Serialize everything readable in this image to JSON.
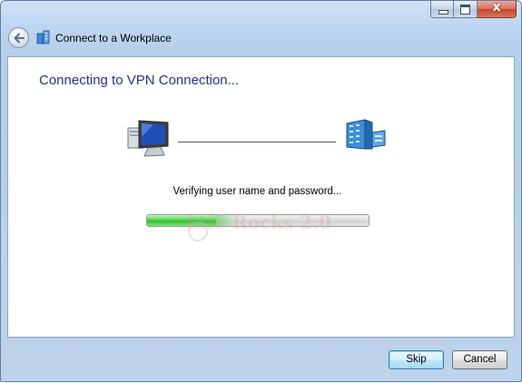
{
  "window": {
    "title": "Connect to a Workplace",
    "close_glyph": "x",
    "controls": [
      "minimize-icon",
      "maximize-icon",
      "close-icon"
    ]
  },
  "main": {
    "heading": "Connecting to VPN Connection...",
    "status": "Verifying user name and password...",
    "progress_fraction": 0.31,
    "watermark": "Life Rocks 2.0",
    "icons": [
      "computer-icon",
      "server-icon"
    ]
  },
  "footer": {
    "skip_label": "Skip",
    "cancel_label": "Cancel"
  },
  "colors": {
    "heading": "#1e3a8c",
    "progress_green": "#2fbf2d"
  }
}
